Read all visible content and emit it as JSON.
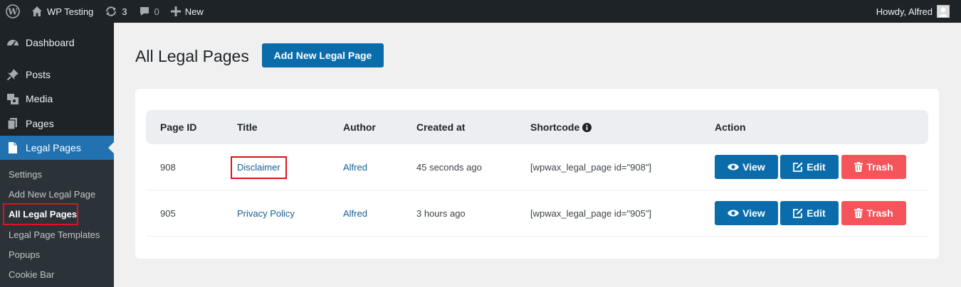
{
  "admin_bar": {
    "site_name": "WP Testing",
    "updates_count": "3",
    "comments_count": "0",
    "new_label": "New",
    "greeting": "Howdy, Alfred"
  },
  "sidebar": {
    "items": [
      {
        "label": "Dashboard",
        "icon": "dashboard-icon"
      },
      {
        "label": "Posts",
        "icon": "pushpin-icon"
      },
      {
        "label": "Media",
        "icon": "media-icon"
      },
      {
        "label": "Pages",
        "icon": "pages-icon"
      },
      {
        "label": "Legal Pages",
        "icon": "legal-page-icon"
      }
    ],
    "submenu": [
      {
        "label": "Settings"
      },
      {
        "label": "Add New Legal Page"
      },
      {
        "label": "All Legal Pages"
      },
      {
        "label": "Legal Page Templates"
      },
      {
        "label": "Popups"
      },
      {
        "label": "Cookie Bar"
      }
    ]
  },
  "main": {
    "title": "All Legal Pages",
    "add_button": "Add New Legal Page"
  },
  "table": {
    "headers": {
      "page_id": "Page ID",
      "title": "Title",
      "author": "Author",
      "created": "Created at",
      "shortcode": "Shortcode",
      "action": "Action"
    },
    "rows": [
      {
        "id": "908",
        "title": "Disclaimer",
        "author": "Alfred",
        "created": "45 seconds ago",
        "shortcode": "[wpwax_legal_page id=\"908\"]"
      },
      {
        "id": "905",
        "title": "Privacy Policy",
        "author": "Alfred",
        "created": "3 hours ago",
        "shortcode": "[wpwax_legal_page id=\"905\"]"
      }
    ],
    "actions": {
      "view": "View",
      "edit": "Edit",
      "trash": "Trash"
    }
  },
  "colors": {
    "admin_bar": "#1d2327",
    "accent_blue": "#0b6cab",
    "current_menu": "#2271b1",
    "trash_red": "#f5545a",
    "highlight_red": "#e0101e"
  }
}
